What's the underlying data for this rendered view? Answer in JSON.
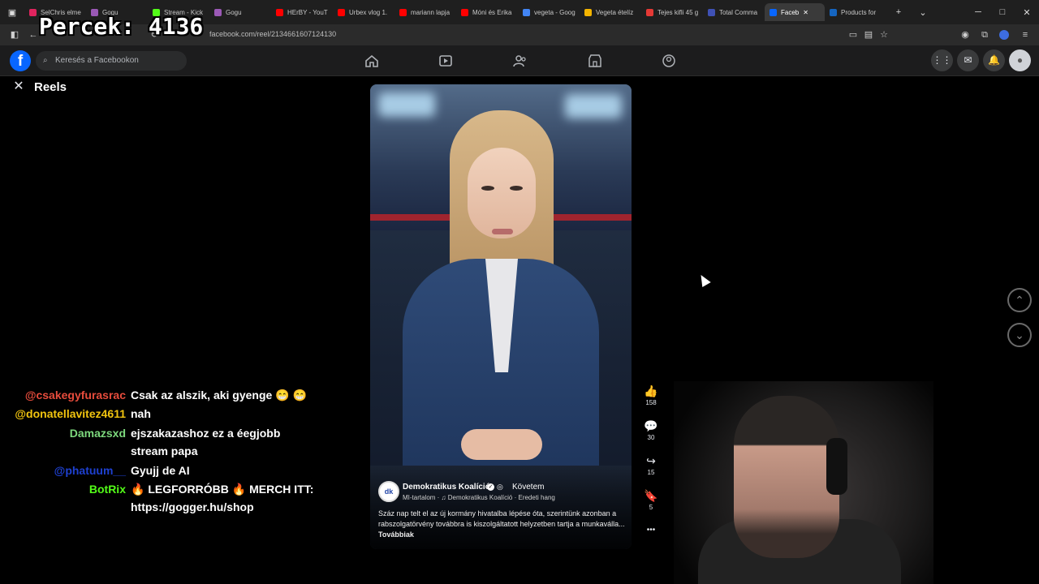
{
  "browser": {
    "tabs": [
      {
        "label": "SelChris elme",
        "color": "#e0245e"
      },
      {
        "label": "Gogu",
        "color": "#9b59b6"
      },
      {
        "label": "Stream - Kick",
        "color": "#53fc18"
      },
      {
        "label": "Gogu",
        "color": "#9b59b6"
      },
      {
        "label": "HErBY - YouT",
        "color": "#ff0000"
      },
      {
        "label": "Urbex vlog 1.",
        "color": "#ff0000"
      },
      {
        "label": "mariann lapja",
        "color": "#ff0000"
      },
      {
        "label": "Móni és Erika",
        "color": "#ff0000"
      },
      {
        "label": "vegeta - Goog",
        "color": "#4285f4"
      },
      {
        "label": "Vegeta ételíz",
        "color": "#f4b400"
      },
      {
        "label": "Tejes kifli 45 g",
        "color": "#e53935"
      },
      {
        "label": "Total Comma",
        "color": "#3f51b5"
      },
      {
        "label": "Faceb",
        "color": "#0866ff",
        "active": true
      },
      {
        "label": "Products for",
        "color": "#1565c0"
      }
    ],
    "url": "facebook.com/reel/2134661607124130",
    "window_controls": [
      "─",
      "□",
      "✕"
    ]
  },
  "overlay": {
    "counter_text": "Percek: 4136"
  },
  "facebook": {
    "logo_letter": "f",
    "search_placeholder": "Keresés a Facebookon",
    "nav_icons": [
      "home-icon",
      "video-icon",
      "friends-icon",
      "marketplace-icon",
      "groups-icon"
    ],
    "right_icons": [
      "menu-grid-icon",
      "messenger-icon",
      "notifications-icon",
      "profile-avatar"
    ]
  },
  "reels": {
    "title": "Reels",
    "channel": {
      "avatar_text": "dk",
      "name": "Demokratikus Koalíció",
      "follow_label": "Követem",
      "subline": "MI-tartalom · ♫ Demokratikus Koalíció · Eredeti hang",
      "description": "Száz nap telt el az új kormány hivatalba lépése óta, szerintünk azonban a rabszolgatörvény továbbra is kiszolgáltatott helyzetben tartja a munkaválla...",
      "more_label": "Továbbiak"
    },
    "actions": [
      {
        "name": "like",
        "icon": "👍",
        "count": "158"
      },
      {
        "name": "comment",
        "icon": "💬",
        "count": "30"
      },
      {
        "name": "share",
        "icon": "↪",
        "count": "15"
      },
      {
        "name": "save",
        "icon": "🔖",
        "count": "5"
      },
      {
        "name": "more",
        "icon": "•••",
        "count": ""
      }
    ]
  },
  "chat": [
    {
      "user": "@csakegyfurasrac",
      "user_color": "#e74c3c",
      "message": "Csak az alszik, aki gyenge 😁 😁"
    },
    {
      "user": "@donatellavitez4611",
      "user_color": "#f1c40f",
      "message": "nah"
    },
    {
      "user": "Damazsxd",
      "user_color": "#7dd87d",
      "message": "ejszakazashoz ez a éegjobb"
    },
    {
      "user": "",
      "user_color": "#ffffff",
      "message": "stream papa"
    },
    {
      "user": "@phatuum__",
      "user_color": "#1e40d0",
      "message": "Gyujj de AI"
    },
    {
      "user": "BotRix",
      "user_color": "#53fc18",
      "message": "🔥 LEGFORRÓBB 🔥 MERCH ITT:"
    },
    {
      "user": "",
      "user_color": "#ffffff",
      "message": "https://gogger.hu/shop"
    }
  ]
}
